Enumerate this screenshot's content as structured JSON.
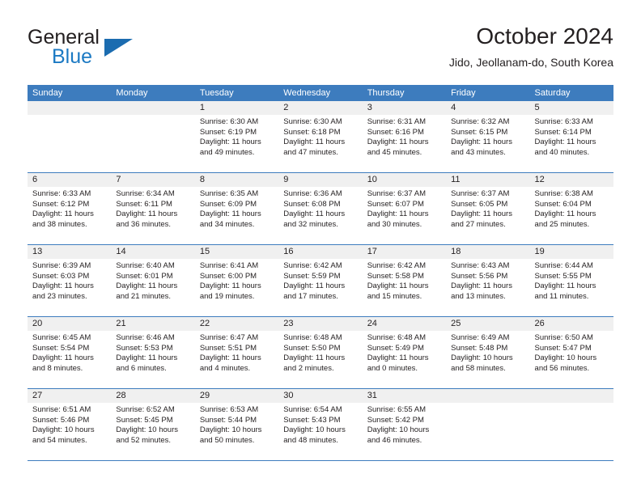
{
  "brand": {
    "name_top": "General",
    "name_bottom": "Blue"
  },
  "header": {
    "title": "October 2024",
    "subtitle": "Jido, Jeollanam-do, South Korea"
  },
  "colors": {
    "header_blue": "#3d7cbe",
    "logo_blue": "#1b79c3",
    "daynum_band": "#f0f0f0",
    "text": "#231f20"
  },
  "weekday_headers": [
    "Sunday",
    "Monday",
    "Tuesday",
    "Wednesday",
    "Thursday",
    "Friday",
    "Saturday"
  ],
  "weeks": [
    [
      {
        "day": ""
      },
      {
        "day": ""
      },
      {
        "day": "1",
        "sunrise": "Sunrise: 6:30 AM",
        "sunset": "Sunset: 6:19 PM",
        "daylight": "Daylight: 11 hours and 49 minutes."
      },
      {
        "day": "2",
        "sunrise": "Sunrise: 6:30 AM",
        "sunset": "Sunset: 6:18 PM",
        "daylight": "Daylight: 11 hours and 47 minutes."
      },
      {
        "day": "3",
        "sunrise": "Sunrise: 6:31 AM",
        "sunset": "Sunset: 6:16 PM",
        "daylight": "Daylight: 11 hours and 45 minutes."
      },
      {
        "day": "4",
        "sunrise": "Sunrise: 6:32 AM",
        "sunset": "Sunset: 6:15 PM",
        "daylight": "Daylight: 11 hours and 43 minutes."
      },
      {
        "day": "5",
        "sunrise": "Sunrise: 6:33 AM",
        "sunset": "Sunset: 6:14 PM",
        "daylight": "Daylight: 11 hours and 40 minutes."
      }
    ],
    [
      {
        "day": "6",
        "sunrise": "Sunrise: 6:33 AM",
        "sunset": "Sunset: 6:12 PM",
        "daylight": "Daylight: 11 hours and 38 minutes."
      },
      {
        "day": "7",
        "sunrise": "Sunrise: 6:34 AM",
        "sunset": "Sunset: 6:11 PM",
        "daylight": "Daylight: 11 hours and 36 minutes."
      },
      {
        "day": "8",
        "sunrise": "Sunrise: 6:35 AM",
        "sunset": "Sunset: 6:09 PM",
        "daylight": "Daylight: 11 hours and 34 minutes."
      },
      {
        "day": "9",
        "sunrise": "Sunrise: 6:36 AM",
        "sunset": "Sunset: 6:08 PM",
        "daylight": "Daylight: 11 hours and 32 minutes."
      },
      {
        "day": "10",
        "sunrise": "Sunrise: 6:37 AM",
        "sunset": "Sunset: 6:07 PM",
        "daylight": "Daylight: 11 hours and 30 minutes."
      },
      {
        "day": "11",
        "sunrise": "Sunrise: 6:37 AM",
        "sunset": "Sunset: 6:05 PM",
        "daylight": "Daylight: 11 hours and 27 minutes."
      },
      {
        "day": "12",
        "sunrise": "Sunrise: 6:38 AM",
        "sunset": "Sunset: 6:04 PM",
        "daylight": "Daylight: 11 hours and 25 minutes."
      }
    ],
    [
      {
        "day": "13",
        "sunrise": "Sunrise: 6:39 AM",
        "sunset": "Sunset: 6:03 PM",
        "daylight": "Daylight: 11 hours and 23 minutes."
      },
      {
        "day": "14",
        "sunrise": "Sunrise: 6:40 AM",
        "sunset": "Sunset: 6:01 PM",
        "daylight": "Daylight: 11 hours and 21 minutes."
      },
      {
        "day": "15",
        "sunrise": "Sunrise: 6:41 AM",
        "sunset": "Sunset: 6:00 PM",
        "daylight": "Daylight: 11 hours and 19 minutes."
      },
      {
        "day": "16",
        "sunrise": "Sunrise: 6:42 AM",
        "sunset": "Sunset: 5:59 PM",
        "daylight": "Daylight: 11 hours and 17 minutes."
      },
      {
        "day": "17",
        "sunrise": "Sunrise: 6:42 AM",
        "sunset": "Sunset: 5:58 PM",
        "daylight": "Daylight: 11 hours and 15 minutes."
      },
      {
        "day": "18",
        "sunrise": "Sunrise: 6:43 AM",
        "sunset": "Sunset: 5:56 PM",
        "daylight": "Daylight: 11 hours and 13 minutes."
      },
      {
        "day": "19",
        "sunrise": "Sunrise: 6:44 AM",
        "sunset": "Sunset: 5:55 PM",
        "daylight": "Daylight: 11 hours and 11 minutes."
      }
    ],
    [
      {
        "day": "20",
        "sunrise": "Sunrise: 6:45 AM",
        "sunset": "Sunset: 5:54 PM",
        "daylight": "Daylight: 11 hours and 8 minutes."
      },
      {
        "day": "21",
        "sunrise": "Sunrise: 6:46 AM",
        "sunset": "Sunset: 5:53 PM",
        "daylight": "Daylight: 11 hours and 6 minutes."
      },
      {
        "day": "22",
        "sunrise": "Sunrise: 6:47 AM",
        "sunset": "Sunset: 5:51 PM",
        "daylight": "Daylight: 11 hours and 4 minutes."
      },
      {
        "day": "23",
        "sunrise": "Sunrise: 6:48 AM",
        "sunset": "Sunset: 5:50 PM",
        "daylight": "Daylight: 11 hours and 2 minutes."
      },
      {
        "day": "24",
        "sunrise": "Sunrise: 6:48 AM",
        "sunset": "Sunset: 5:49 PM",
        "daylight": "Daylight: 11 hours and 0 minutes."
      },
      {
        "day": "25",
        "sunrise": "Sunrise: 6:49 AM",
        "sunset": "Sunset: 5:48 PM",
        "daylight": "Daylight: 10 hours and 58 minutes."
      },
      {
        "day": "26",
        "sunrise": "Sunrise: 6:50 AM",
        "sunset": "Sunset: 5:47 PM",
        "daylight": "Daylight: 10 hours and 56 minutes."
      }
    ],
    [
      {
        "day": "27",
        "sunrise": "Sunrise: 6:51 AM",
        "sunset": "Sunset: 5:46 PM",
        "daylight": "Daylight: 10 hours and 54 minutes."
      },
      {
        "day": "28",
        "sunrise": "Sunrise: 6:52 AM",
        "sunset": "Sunset: 5:45 PM",
        "daylight": "Daylight: 10 hours and 52 minutes."
      },
      {
        "day": "29",
        "sunrise": "Sunrise: 6:53 AM",
        "sunset": "Sunset: 5:44 PM",
        "daylight": "Daylight: 10 hours and 50 minutes."
      },
      {
        "day": "30",
        "sunrise": "Sunrise: 6:54 AM",
        "sunset": "Sunset: 5:43 PM",
        "daylight": "Daylight: 10 hours and 48 minutes."
      },
      {
        "day": "31",
        "sunrise": "Sunrise: 6:55 AM",
        "sunset": "Sunset: 5:42 PM",
        "daylight": "Daylight: 10 hours and 46 minutes."
      },
      {
        "day": ""
      },
      {
        "day": ""
      }
    ]
  ]
}
